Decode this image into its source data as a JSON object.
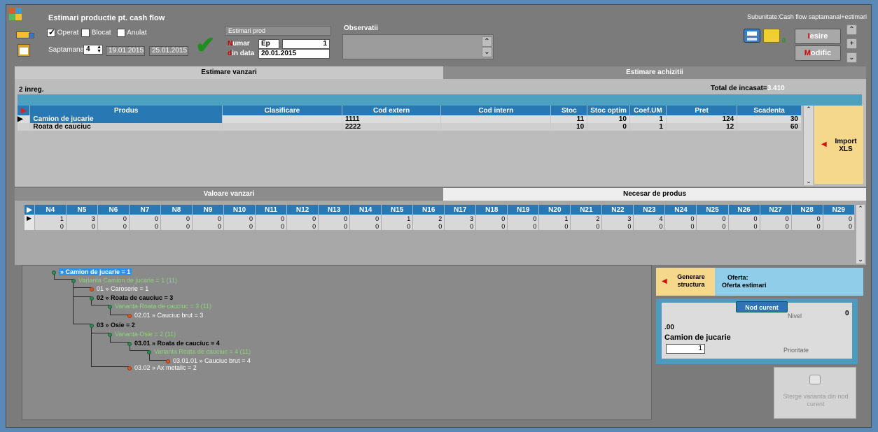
{
  "window": {
    "title": "Estimari productie pt. cash flow",
    "subunit": "Subunitate:Cash flow saptamanal+estimari"
  },
  "filters": {
    "operat_label": "Operat",
    "blocat_label": "Blocat",
    "anulat_label": "Anulat",
    "saptamana_label": "Saptamana",
    "saptamana_value": "4",
    "date_from": "19.01.2015",
    "date_to": "25.01.2015"
  },
  "doc": {
    "header": "Estimari prod",
    "numar_label": "Numar",
    "numar_prefix": "Ep",
    "numar_value": "1",
    "data_label": "din data",
    "data_value": "20.01.2015",
    "observatii_label": "Observatii"
  },
  "toolbar": {
    "count_zero": "0",
    "iesire_hk": "I",
    "iesire_rest": "esire",
    "modific_hk": "M",
    "modific_rest": "odific"
  },
  "tabs_top": {
    "sales": "Estimare vanzari",
    "purchases": "Estimare achizitii"
  },
  "sales_grid": {
    "record_count": "2 inreg.",
    "total_label": "Total de incasat=",
    "total_value": "3.410",
    "columns": [
      "Produs",
      "Clasificare",
      "Cod extern",
      "Cod intern",
      "Stoc",
      "Stoc optim",
      "Coef.UM",
      "Pret",
      "Scadenta"
    ],
    "rows": [
      {
        "produs": "Camion de jucarie",
        "clasificare": "",
        "cod_extern": "1111",
        "cod_intern": "",
        "stoc": "11",
        "stoc_optim": "10",
        "coef": "1",
        "pret": "124",
        "scadenta": "30"
      },
      {
        "produs": "Roata de cauciuc",
        "clasificare": "",
        "cod_extern": "2222",
        "cod_intern": "",
        "stoc": "10",
        "stoc_optim": "0",
        "coef": "1",
        "pret": "12",
        "scadenta": "60"
      }
    ],
    "import_label": "Import XLS"
  },
  "tabs_mid": {
    "valoare": "Valoare vanzari",
    "necesar": "Necesar de produs"
  },
  "weeks_grid": {
    "columns": [
      "N4",
      "N5",
      "N6",
      "N7",
      "N8",
      "N9",
      "N10",
      "N11",
      "N12",
      "N13",
      "N14",
      "N15",
      "N16",
      "N17",
      "N18",
      "N19",
      "N20",
      "N21",
      "N22",
      "N23",
      "N24",
      "N25",
      "N26",
      "N27",
      "N28",
      "N29"
    ],
    "rows": [
      [
        "1",
        "3",
        "0",
        "0",
        "0",
        "0",
        "0",
        "0",
        "0",
        "0",
        "0",
        "1",
        "2",
        "3",
        "0",
        "0",
        "1",
        "2",
        "3",
        "4",
        "0",
        "0",
        "0",
        "0",
        "0",
        "0"
      ],
      [
        "0",
        "0",
        "0",
        "0",
        "0",
        "0",
        "0",
        "0",
        "0",
        "0",
        "0",
        "0",
        "0",
        "0",
        "0",
        "0",
        "0",
        "0",
        "0",
        "0",
        "0",
        "0",
        "0",
        "0",
        "0",
        "0"
      ]
    ]
  },
  "tree": {
    "root": "» Camion de jucarie = 1",
    "n1": "Varianta Camion de jucarie = 1 (11)",
    "n2": "01 » Caroserie = 1",
    "n3": "02 » Roata de cauciuc = 3",
    "n4": "Varianta Roata de cauciuc = 3 (11)",
    "n5": "02.01 » Cauciuc brut = 3",
    "n6": "03 » Osie = 2",
    "n7": "Varianta Osie = 2 (11)",
    "n8": "03.01 » Roata de cauciuc = 4",
    "n9": "Varianta Roata de cauciuc = 4 (11)",
    "n10": "03.01.01 » Cauciuc brut = 4",
    "n11": "03.02 » Ax metalic = 2"
  },
  "right_panel": {
    "generare_label": "Generare structura",
    "oferta_label": "Oferta:",
    "oferta_value": "Oferta estimari",
    "nod_curent_tab": "Nod curent",
    "nivel_label": "Nivel",
    "nivel_value": "0",
    "code": ".00",
    "product": "Camion de jucarie",
    "prioritate_input": "1",
    "prioritate_label": "Prioritate",
    "sterge_label": "Sterge varianta din nod curent"
  }
}
